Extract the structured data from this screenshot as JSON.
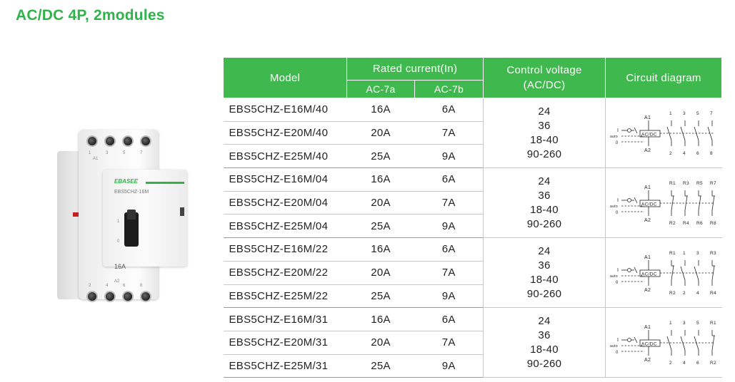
{
  "title": "AC/DC 4P, 2modules",
  "product": {
    "brand": "EBASEE",
    "model_print": "EBS5CHZ-16M",
    "rating_print": "16A",
    "terminal_a1": "A1",
    "terminal_a2": "A2",
    "top_terminals": [
      "1",
      "3",
      "5",
      "7"
    ],
    "bottom_terminals": [
      "2",
      "4",
      "6",
      "8"
    ],
    "switch_positions": [
      "1",
      "0"
    ]
  },
  "table": {
    "headers": {
      "model": "Model",
      "rated_current": "Rated current(In)",
      "ac7a": "AC-7a",
      "ac7b": "AC-7b",
      "control_voltage": "Control voltage",
      "control_voltage_unit": "(AC/DC)",
      "circuit_diagram": "Circuit diagram"
    },
    "groups": [
      {
        "rows": [
          {
            "model": "EBS5CHZ-E16M/40",
            "ac7a": "16A",
            "ac7b": "6A"
          },
          {
            "model": "EBS5CHZ-E20M/40",
            "ac7a": "20A",
            "ac7b": "7A"
          },
          {
            "model": "EBS5CHZ-E25M/40",
            "ac7a": "25A",
            "ac7b": "9A"
          }
        ],
        "voltages": [
          "24",
          "36",
          "18-40",
          "90-260"
        ],
        "diagram": {
          "top": [
            "A1",
            "1",
            "3",
            "5",
            "7"
          ],
          "bottom": [
            "A2",
            "2",
            "4",
            "6",
            "8"
          ],
          "contacts": [
            "no",
            "no",
            "no",
            "no"
          ]
        }
      },
      {
        "rows": [
          {
            "model": "EBS5CHZ-E16M/04",
            "ac7a": "16A",
            "ac7b": "6A"
          },
          {
            "model": "EBS5CHZ-E20M/04",
            "ac7a": "20A",
            "ac7b": "7A"
          },
          {
            "model": "EBS5CHZ-E25M/04",
            "ac7a": "25A",
            "ac7b": "9A"
          }
        ],
        "voltages": [
          "24",
          "36",
          "18-40",
          "90-260"
        ],
        "diagram": {
          "top": [
            "A1",
            "R1",
            "R3",
            "R5",
            "R7"
          ],
          "bottom": [
            "A2",
            "R2",
            "R4",
            "R6",
            "R8"
          ],
          "contacts": [
            "nc",
            "nc",
            "nc",
            "nc"
          ]
        }
      },
      {
        "rows": [
          {
            "model": "EBS5CHZ-E16M/22",
            "ac7a": "16A",
            "ac7b": "6A"
          },
          {
            "model": "EBS5CHZ-E20M/22",
            "ac7a": "20A",
            "ac7b": "7A"
          },
          {
            "model": "EBS5CHZ-E25M/22",
            "ac7a": "25A",
            "ac7b": "9A"
          }
        ],
        "voltages": [
          "24",
          "36",
          "18-40",
          "90-260"
        ],
        "diagram": {
          "top": [
            "A1",
            "R1",
            "1",
            "3",
            "R3"
          ],
          "bottom": [
            "A2",
            "R2",
            "2",
            "4",
            "R4"
          ],
          "contacts": [
            "nc",
            "no",
            "no",
            "nc"
          ]
        }
      },
      {
        "rows": [
          {
            "model": "EBS5CHZ-E16M/31",
            "ac7a": "16A",
            "ac7b": "6A"
          },
          {
            "model": "EBS5CHZ-E20M/31",
            "ac7a": "20A",
            "ac7b": "7A"
          },
          {
            "model": "EBS5CHZ-E25M/31",
            "ac7a": "25A",
            "ac7b": "9A"
          }
        ],
        "voltages": [
          "24",
          "36",
          "18-40",
          "90-260"
        ],
        "diagram": {
          "top": [
            "A1",
            "1",
            "3",
            "5",
            "R1"
          ],
          "bottom": [
            "A2",
            "2",
            "4",
            "6",
            "R2"
          ],
          "contacts": [
            "no",
            "no",
            "no",
            "nc"
          ]
        }
      }
    ],
    "diagram_labels": {
      "coil": "AC/DC",
      "switch_on": "I",
      "switch_auto": "auto",
      "switch_off": "0"
    },
    "header_color": "#3fb94d"
  }
}
